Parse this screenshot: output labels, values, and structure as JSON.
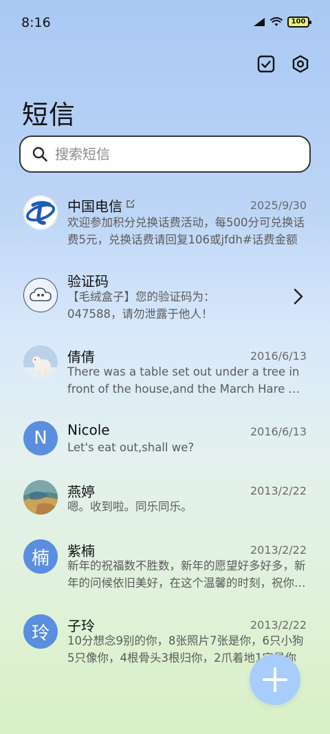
{
  "status_bar": {
    "time": "8:16",
    "battery": "100"
  },
  "header": {
    "title": "短信"
  },
  "search": {
    "placeholder": "搜索短信"
  },
  "messages": [
    {
      "name": "中国电信",
      "date": "2025/9/30",
      "preview": "欢迎参加积分兑换话费活动，每500分可兑换话费5元，兑换话费请回复106或jfdh#话费金额",
      "avatar": "china-telecom-logo"
    },
    {
      "name": "验证码",
      "date": "",
      "preview": "【毛绒盒子】您的验证码为：047588，请勿泄露于他人！",
      "avatar": "cloud-icon"
    },
    {
      "name": "倩倩",
      "date": "2016/6/13",
      "preview": "There was a table set out under a tree in front of the house,and the March Hare and the Hatter",
      "avatar": "polar-bear-photo"
    },
    {
      "name": "Nicole",
      "date": "2016/6/13",
      "preview": "Let's eat out,shall we?",
      "avatar_letter": "N"
    },
    {
      "name": "燕婷",
      "date": "2013/2/22",
      "preview": "嗯。收到啦。同乐同乐。",
      "avatar": "landscape-photo"
    },
    {
      "name": "紫楠",
      "date": "2013/2/22",
      "preview": "新年的祝福数不胜数，新年的愿望好多好多，新年的问候依旧美好，在这个温馨的时刻，祝你新年快乐",
      "avatar_letter": "楠"
    },
    {
      "name": "子玲",
      "date": "2013/2/22",
      "preview": "10分想念9别的你，8张照片7张是你，6只小狗5只像你，4根骨头3根归你，2爪着地1定是你",
      "avatar_letter": "玲"
    }
  ],
  "colors": {
    "accent": "#5b8ede",
    "fab": "#a8cdfa"
  }
}
